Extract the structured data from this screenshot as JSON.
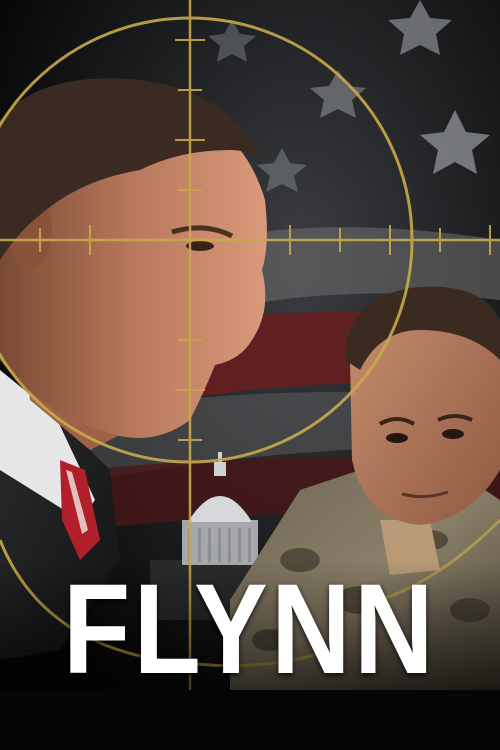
{
  "poster": {
    "title": "FLYNN"
  },
  "colors": {
    "crosshair": "#c9a94a",
    "flag_red": "#6a1d1f",
    "background": "#070707",
    "title_text": "#ffffff"
  },
  "icons": {
    "reticle": "crosshair-reticle-icon",
    "stars": "flag-star-icon",
    "building": "capitol-dome-icon"
  }
}
